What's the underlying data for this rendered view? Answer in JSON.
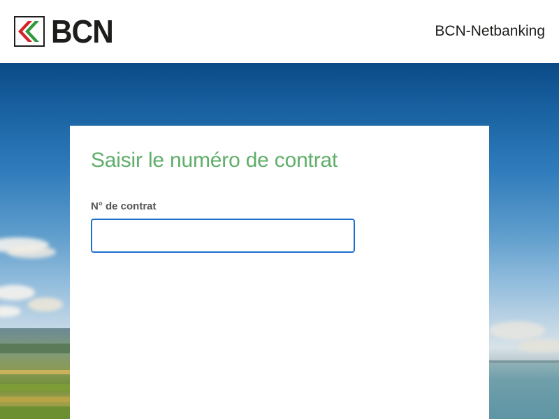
{
  "header": {
    "logo_text": "BCN",
    "logo_icon": "bcn-chevron-logo-icon",
    "app_name": "BCN-Netbanking"
  },
  "colors": {
    "logo_red": "#d5232b",
    "logo_green": "#2f9a3e",
    "title_green": "#5fae6a",
    "input_border": "#1f6fcf",
    "label_gray": "#555555"
  },
  "form": {
    "title": "Saisir le numéro de contrat",
    "contract_label": "N° de contrat",
    "contract_value": "",
    "contract_placeholder": ""
  }
}
